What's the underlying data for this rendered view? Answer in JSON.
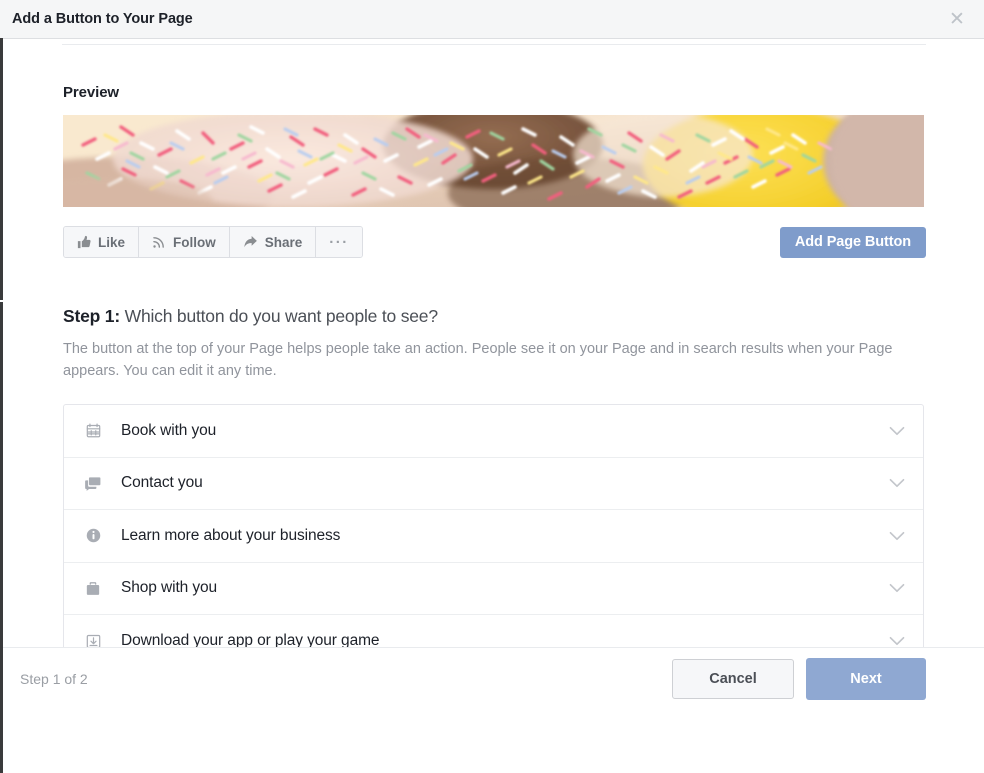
{
  "dialog": {
    "title": "Add a Button to Your Page",
    "close_icon": "close-icon",
    "close_glyph": "✕"
  },
  "preview": {
    "label": "Preview",
    "cover_photo_alt": "Donuts covered with colorful sprinkles",
    "page_buttons": [
      {
        "label": "Like",
        "icon": "thumbs-up-icon"
      },
      {
        "label": "Follow",
        "icon": "rss-follow-icon"
      },
      {
        "label": "Share",
        "icon": "share-arrow-icon"
      },
      {
        "label": "···",
        "icon": "ellipsis-icon"
      }
    ],
    "add_page_button": {
      "label": "Add Page Button",
      "color": "#7f9ccb"
    }
  },
  "step": {
    "number_label": "Step 1:",
    "question": "Which button do you want people to see?",
    "description": "The button at the top of your Page helps people take an action. People see it on your Page and in search results when your Page appears. You can edit it any time."
  },
  "options": [
    {
      "label": "Book with you",
      "icon": "calendar-icon",
      "chevron": "chevron-down-icon"
    },
    {
      "label": "Contact you",
      "icon": "speech-bubbles-icon",
      "chevron": "chevron-down-icon"
    },
    {
      "label": "Learn more about your business",
      "icon": "info-circle-icon",
      "chevron": "chevron-down-icon"
    },
    {
      "label": "Shop with you",
      "icon": "shopping-bag-icon",
      "chevron": "chevron-down-icon"
    },
    {
      "label": "Download your app or play your game",
      "icon": "download-icon",
      "chevron": "chevron-down-icon"
    }
  ],
  "footer": {
    "step_counter": "Step 1 of 2",
    "cancel_label": "Cancel",
    "next_label": "Next",
    "next_color": "#8fa8d2"
  }
}
